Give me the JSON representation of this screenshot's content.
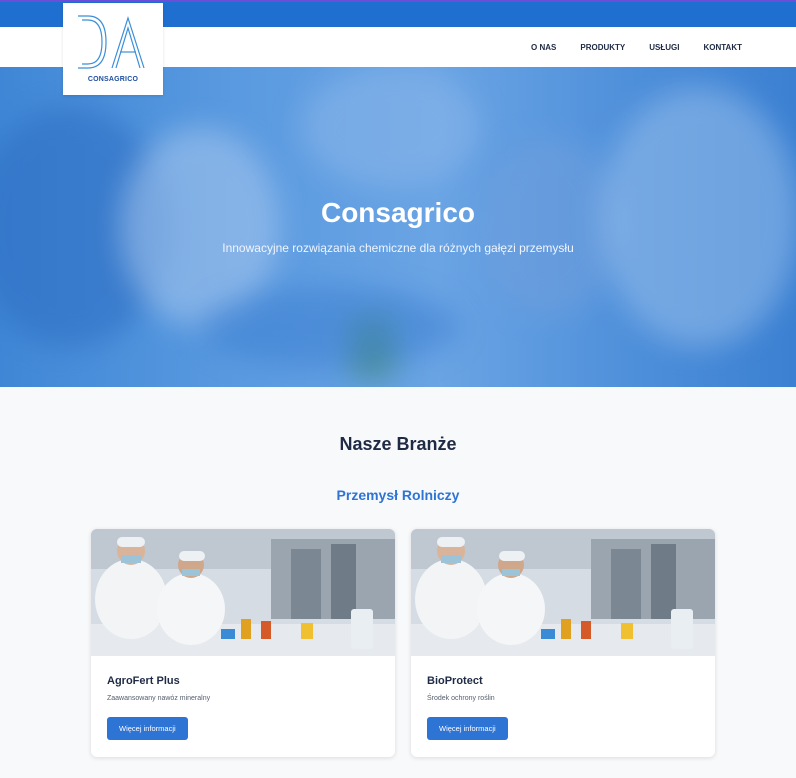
{
  "logo": {
    "text": "CONSAGRICO"
  },
  "nav": {
    "items": [
      "O NAS",
      "PRODUKTY",
      "USŁUGI",
      "KONTAKT"
    ]
  },
  "hero": {
    "title": "Consagrico",
    "subtitle": "Innowacyjne rozwiązania chemiczne dla różnych gałęzi przemysłu"
  },
  "section": {
    "title": "Nasze Branże",
    "subtitle": "Przemysł Rolniczy"
  },
  "cards": [
    {
      "title": "AgroFert Plus",
      "description": "Zaawansowany nawóz mineralny",
      "button": "Więcej informacji"
    },
    {
      "title": "BioProtect",
      "description": "Środek ochrony roślin",
      "button": "Więcej informacji"
    }
  ],
  "colors": {
    "accent": "#2e74d4",
    "topbar": "#1f6fd1",
    "text": "#1f2a44"
  }
}
